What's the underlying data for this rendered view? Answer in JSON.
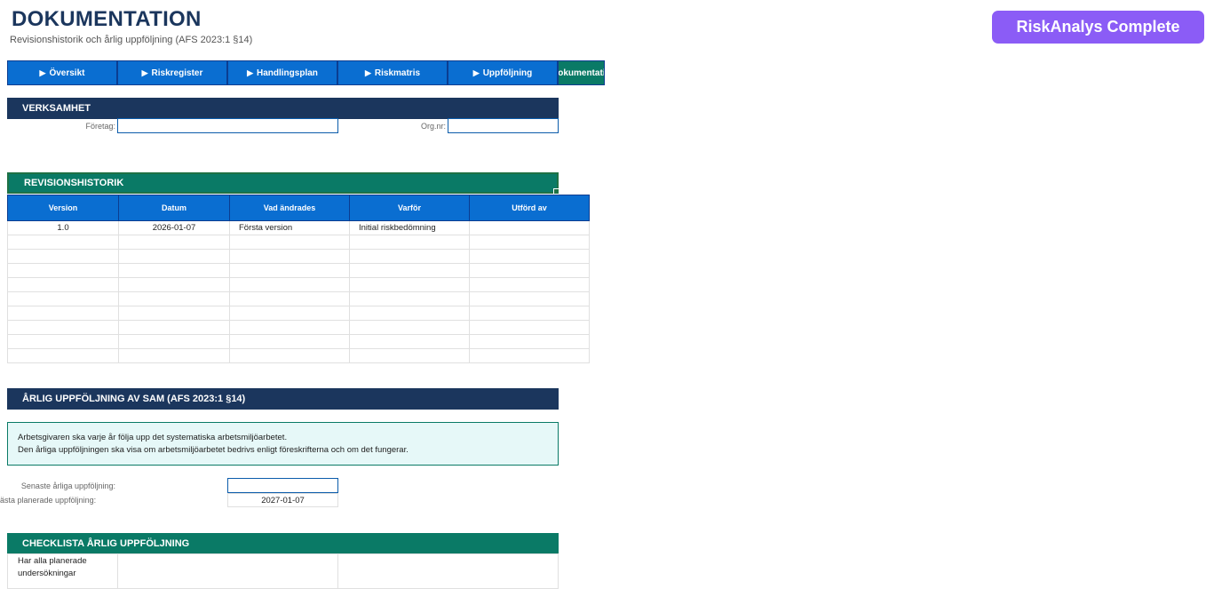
{
  "header": {
    "title": "DOKUMENTATION",
    "subtitle": "Revisionshistorik och årlig uppföljning (AFS 2023:1 §14)",
    "brand": "RiskAnalys Complete"
  },
  "nav": {
    "arrow": "▶",
    "items": [
      "Översikt",
      "Riskregister",
      "Handlingsplan",
      "Riskmatris",
      "Uppföljning"
    ],
    "active": "Dokumentation"
  },
  "verksamhet": {
    "heading": "VERKSAMHET",
    "company_label": "Företag:",
    "company_value": "",
    "orgnr_label": "Org.nr:",
    "orgnr_value": ""
  },
  "revision": {
    "heading": "REVISIONSHISTORIK",
    "columns": [
      "Version",
      "Datum",
      "Vad ändrades",
      "Varför",
      "Utförd av"
    ],
    "rows": [
      [
        "1.0",
        "2026-01-07",
        "Första version",
        "Initial riskbedömning",
        ""
      ],
      [
        "",
        "",
        "",
        "",
        ""
      ],
      [
        "",
        "",
        "",
        "",
        ""
      ],
      [
        "",
        "",
        "",
        "",
        ""
      ],
      [
        "",
        "",
        "",
        "",
        ""
      ],
      [
        "",
        "",
        "",
        "",
        ""
      ],
      [
        "",
        "",
        "",
        "",
        ""
      ],
      [
        "",
        "",
        "",
        "",
        ""
      ],
      [
        "",
        "",
        "",
        "",
        ""
      ],
      [
        "",
        "",
        "",
        "",
        ""
      ]
    ]
  },
  "annual": {
    "heading": "ÅRLIG UPPFÖLJNING AV SAM (AFS 2023:1 §14)",
    "info_line1": "Arbetsgivaren ska varje år följa upp det systematiska arbetsmiljöarbetet.",
    "info_line2": "Den årliga uppföljningen ska visa om arbetsmiljöarbetet bedrivs enligt föreskrifterna och om det fungerar.",
    "latest_label": "Senaste årliga uppföljning:",
    "latest_value": "",
    "next_label": "ästa planerade uppföljning:",
    "next_value": "2027-01-07"
  },
  "checklist": {
    "heading": "CHECKLISTA ÅRLIG UPPFÖLJNING",
    "first_item": "Har alla planerade undersökningar"
  },
  "colors": {
    "navy": "#1b365d",
    "nav_blue": "#0a6ed1",
    "teal": "#0a7a66",
    "brand_purple": "#8b5cf6"
  }
}
